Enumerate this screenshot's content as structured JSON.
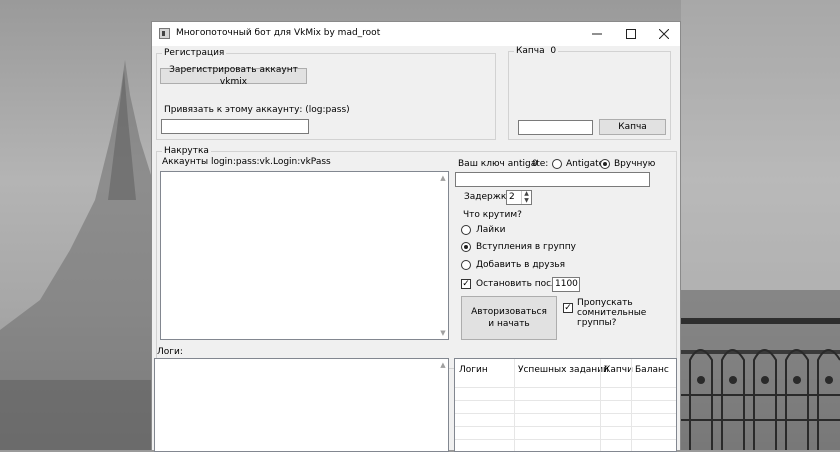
{
  "window": {
    "title": "Многопоточный бот для VkMix by mad_root",
    "minimize_icon": "minimize-icon",
    "maximize_icon": "maximize-icon",
    "close_icon": "close-icon"
  },
  "registration": {
    "legend": "Регистрация",
    "register_button": "Зарегистрировать аккаунт vkmix",
    "bind_label": "Привязать к этому аккаунту:  (log:pass)",
    "bind_value": ""
  },
  "captcha": {
    "legend": "Капча",
    "count": "0",
    "input_value": "",
    "button": "Капча"
  },
  "boost": {
    "legend": "Накрутка",
    "accounts_label": "Аккаунты login:pass:vk.Login:vkPass",
    "antigate_label": "Ваш ключ antigate:",
    "antigate_count": "0",
    "radio_antigate": "Antigate",
    "radio_manual": "Вручную",
    "antigate_key": "",
    "delay_label": "Задержка:",
    "delay_value": "2",
    "what_label": "Что крутим?",
    "options": [
      "Лайки",
      "Вступления в группу",
      "Добавить в друзья"
    ],
    "selected_option": "Вступления в группу",
    "stop_after_label": "Остановить после:",
    "stop_after_value": "1100",
    "start_button": "Авторизоваться и начать",
    "skip_label": "Пропускать сомнительные группы?"
  },
  "logs": {
    "label": "Логи:",
    "columns": [
      "Логин",
      "Успешных заданий",
      "Капчи",
      "Баланс"
    ]
  }
}
